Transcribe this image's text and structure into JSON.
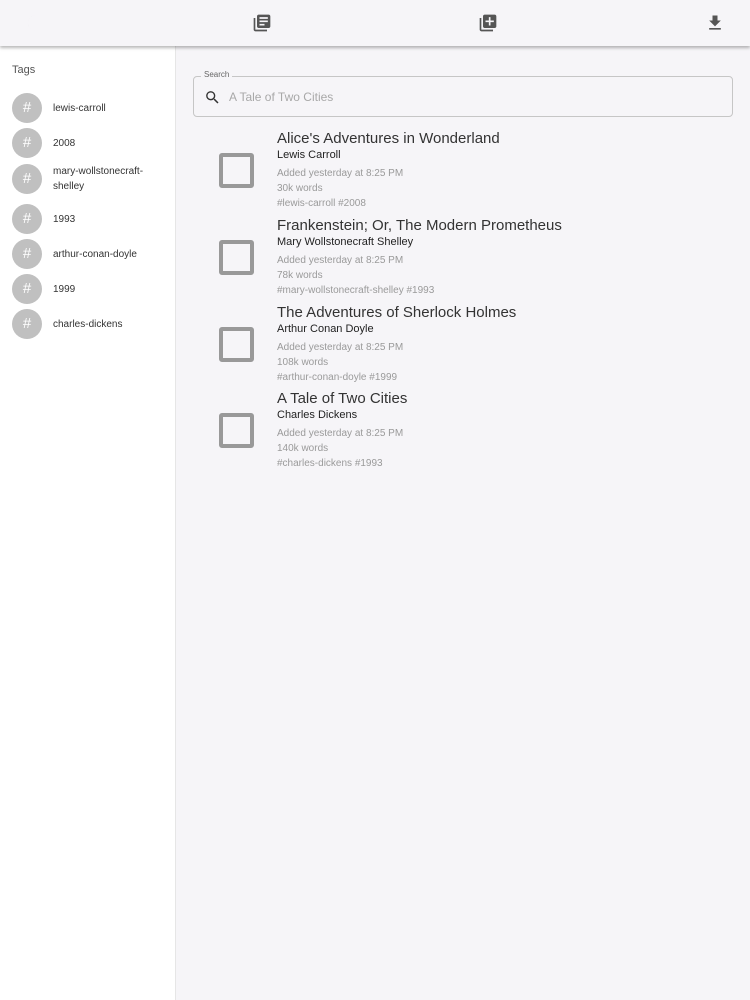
{
  "toolbar": {
    "icons": [
      "dark-mode-icon",
      "library-icon",
      "add-library-icon",
      "download-icon"
    ]
  },
  "sidebar": {
    "title": "Tags",
    "tags": [
      {
        "symbol": "#",
        "label": "lewis-carroll"
      },
      {
        "symbol": "#",
        "label": "2008"
      },
      {
        "symbol": "#",
        "label": "mary-wollstonecraft-shelley"
      },
      {
        "symbol": "#",
        "label": "1993"
      },
      {
        "symbol": "#",
        "label": "arthur-conan-doyle"
      },
      {
        "symbol": "#",
        "label": "1999"
      },
      {
        "symbol": "#",
        "label": "charles-dickens"
      }
    ]
  },
  "search": {
    "label": "Search",
    "value": "",
    "placeholder": "A Tale of Two Cities"
  },
  "books": [
    {
      "title": "Alice's Adventures in Wonderland",
      "author": "Lewis Carroll",
      "added": "Added yesterday at 8:25 PM",
      "words": "30k words",
      "tags": "#lewis-carroll #2008",
      "checked": false
    },
    {
      "title": "Frankenstein; Or, The Modern Prometheus",
      "author": "Mary Wollstonecraft Shelley",
      "added": "Added yesterday at 8:25 PM",
      "words": "78k words",
      "tags": "#mary-wollstonecraft-shelley #1993",
      "checked": false
    },
    {
      "title": "The Adventures of Sherlock Holmes",
      "author": "Arthur Conan Doyle",
      "added": "Added yesterday at 8:25 PM",
      "words": "108k words",
      "tags": "#arthur-conan-doyle #1999",
      "checked": false
    },
    {
      "title": "A Tale of Two Cities",
      "author": "Charles Dickens",
      "added": "Added yesterday at 8:25 PM",
      "words": "140k words",
      "tags": "#charles-dickens #1993",
      "checked": false
    }
  ],
  "colors": {
    "background": "#f6f5f8",
    "avatar": "#c0c0c0",
    "checkbox_border": "#999999"
  }
}
